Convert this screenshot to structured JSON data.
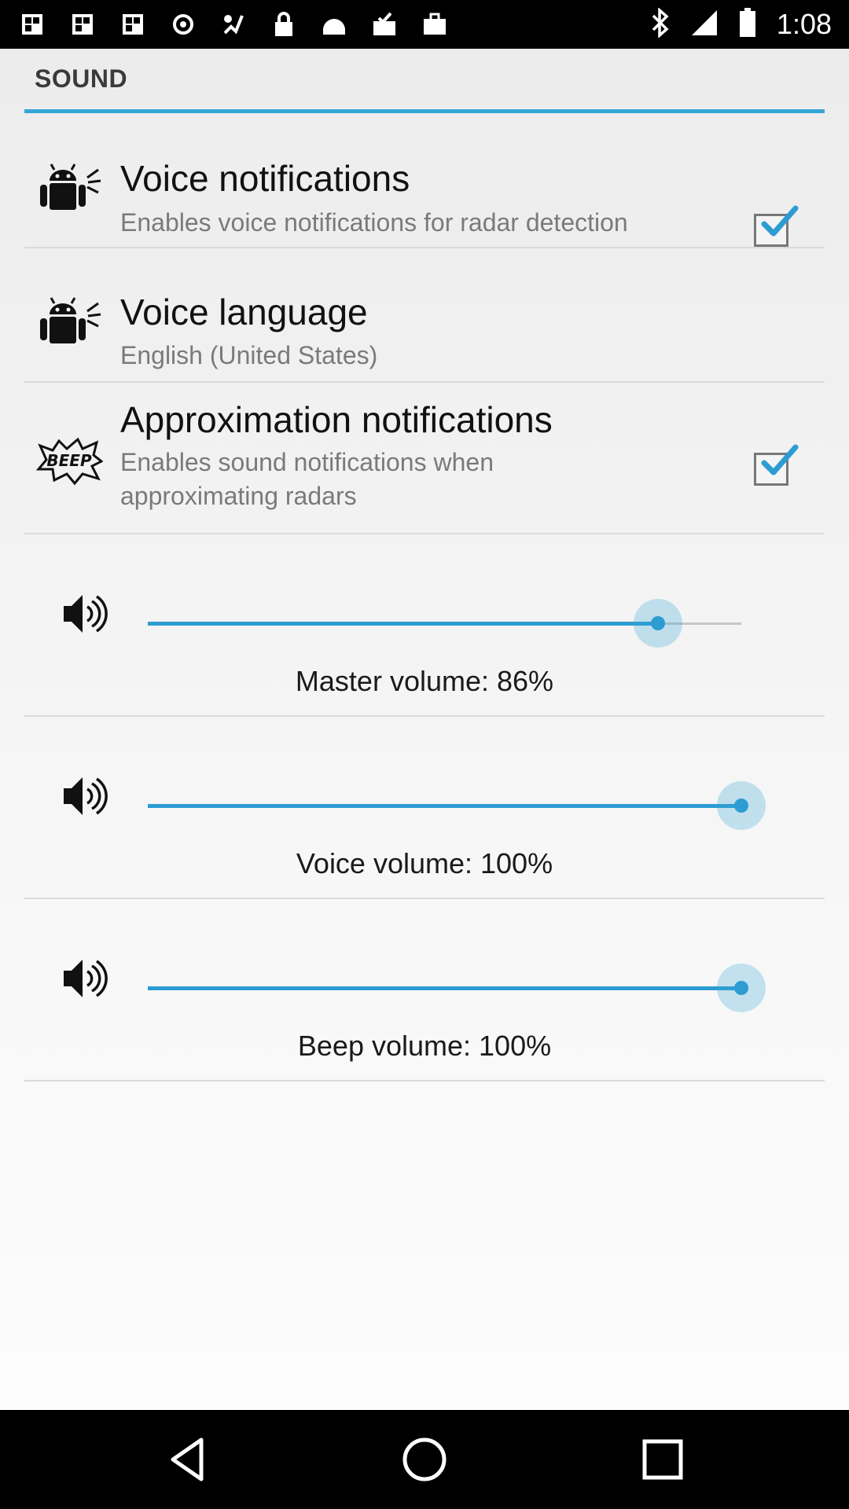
{
  "status_bar": {
    "time": "1:08",
    "left_icons": [
      "image-icon",
      "image-icon",
      "image-icon",
      "sync-icon",
      "fake-gps-icon",
      "lock-icon",
      "android-icon",
      "inbox-check-icon",
      "briefcase-icon"
    ],
    "right_icons": [
      "bluetooth-icon",
      "signal-icon",
      "battery-icon"
    ]
  },
  "section": {
    "title": "SOUND"
  },
  "settings": [
    {
      "title": "Voice notifications",
      "subtitle": "Enables voice notifications for radar detection",
      "icon": "android-speaker-icon",
      "checked": true
    },
    {
      "title": "Voice language",
      "subtitle": "English (United States)",
      "icon": "android-speaker-icon"
    },
    {
      "title": "Approximation notifications",
      "subtitle": "Enables sound notifications when approximating radars",
      "icon": "beep-icon",
      "checked": true
    }
  ],
  "sliders": [
    {
      "label": "Master volume: 86%",
      "value": 0.86
    },
    {
      "label": "Voice volume: 100%",
      "value": 1.0
    },
    {
      "label": "Beep volume: 100%",
      "value": 1.0
    }
  ],
  "nav": {
    "buttons": [
      "back-icon",
      "home-icon",
      "recents-icon"
    ]
  },
  "colors": {
    "accent": "#35a5d8",
    "slider": "#2c9cd2"
  }
}
